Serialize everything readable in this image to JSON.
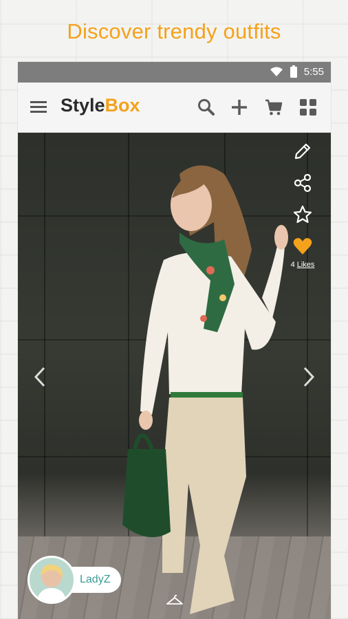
{
  "headline": "Discover trendy outfits",
  "status": {
    "time": "5:55"
  },
  "app": {
    "brand_prefix": "Style",
    "brand_suffix": "Box"
  },
  "actions": {
    "icons": [
      "menu-icon",
      "search-icon",
      "plus-icon",
      "cart-icon",
      "grid-icon"
    ]
  },
  "post": {
    "likes_count": "4",
    "likes_label": "Likes",
    "user_name": "LadyZ"
  },
  "colors": {
    "accent": "#f4a21b",
    "statusbar": "#7d7d7d",
    "user_name": "#3a9c95"
  }
}
